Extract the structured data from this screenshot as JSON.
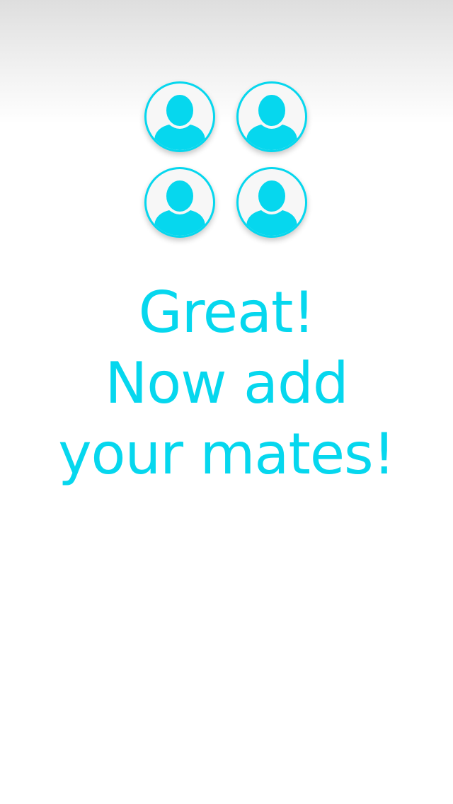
{
  "colors": {
    "accent": "#06d7ee",
    "avatar_background": "#f7f7f7",
    "page_background": "#ffffff"
  },
  "avatars": [
    {
      "icon": "user-avatar-icon"
    },
    {
      "icon": "user-avatar-icon"
    },
    {
      "icon": "user-avatar-icon"
    },
    {
      "icon": "user-avatar-icon"
    }
  ],
  "headline": {
    "line1": "Great!",
    "line2": "Now add",
    "line3": "your mates!"
  }
}
